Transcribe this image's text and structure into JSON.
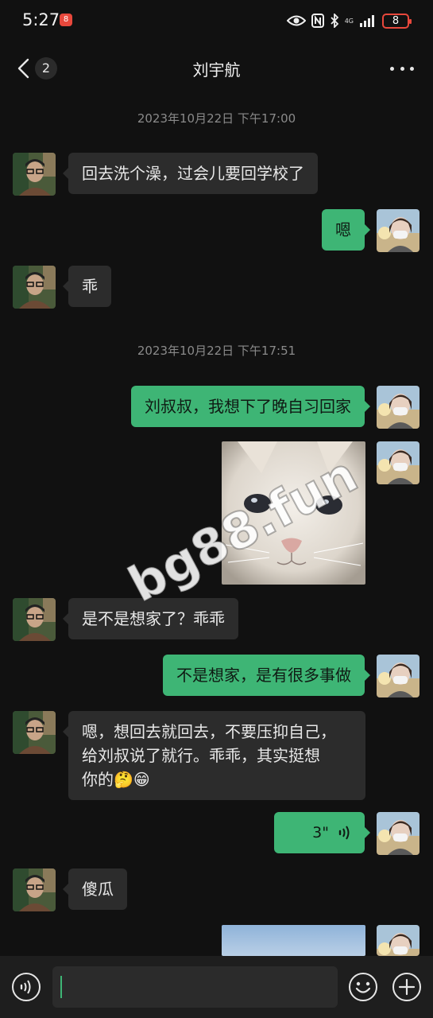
{
  "status_bar": {
    "time": "5:27",
    "notification_badge": "8",
    "battery": "8",
    "network": "4G",
    "icons": [
      "eye-icon",
      "nfc-icon",
      "bluetooth-icon",
      "signal-icon",
      "battery-icon"
    ]
  },
  "header": {
    "title": "刘宇航",
    "unread_count": "2",
    "icons": [
      "back-chevron-icon",
      "more-icon"
    ]
  },
  "conversation": {
    "timestamps": [
      "2023年10月22日 下午17:00",
      "2023年10月22日 下午17:51"
    ],
    "messages": [
      {
        "from": "contact",
        "text": "回去洗个澡，过会儿要回学校了"
      },
      {
        "from": "me",
        "text": "嗯"
      },
      {
        "from": "contact",
        "text": "乖"
      },
      {
        "from": "me",
        "text": "刘叔叔，我想下了晚自习回家"
      },
      {
        "from": "me",
        "type": "image",
        "text": "white cat photo"
      },
      {
        "from": "contact",
        "text": "是不是想家了？乖乖"
      },
      {
        "from": "me",
        "text": "不是想家，是有很多事做"
      },
      {
        "from": "contact",
        "lines": [
          "嗯，想回去就回去，不要压抑自己，",
          "给刘叔说了就行。乖乖，其实挺想",
          "你的🤔😁"
        ]
      },
      {
        "from": "me",
        "type": "voice",
        "duration": "3\""
      },
      {
        "from": "contact",
        "text": "傻瓜"
      },
      {
        "from": "me",
        "type": "image",
        "text": "sky photo"
      }
    ]
  },
  "watermark": "bg88.fun",
  "input_bar": {
    "value": "",
    "icons": [
      "voice-input-icon",
      "emoji-icon",
      "add-icon"
    ]
  },
  "colors": {
    "background": "#111111",
    "incoming_bubble": "#2c2c2c",
    "outgoing_bubble": "#3eb575",
    "timestamp": "#8a8a8a",
    "alert": "#e8483c"
  }
}
